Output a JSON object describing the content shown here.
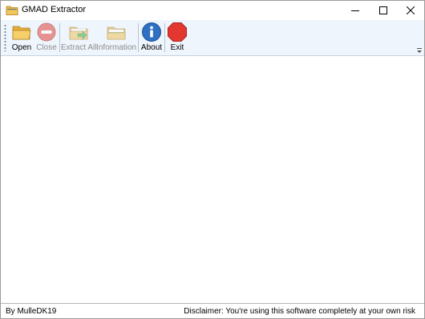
{
  "window": {
    "title": "GMAD Extractor"
  },
  "toolbar": {
    "open": "Open",
    "close": "Close",
    "extract_all": "Extract All",
    "information": "Information",
    "about": "About",
    "exit": "Exit"
  },
  "status": {
    "left": "By MulleDK19",
    "right": "Disclaimer: You're using this software completely at your own risk"
  },
  "icons": {
    "app": "folder-icon",
    "open": "open-folder-icon",
    "close": "close-circle-icon",
    "extract_all": "extract-folder-icon",
    "information": "information-folder-icon",
    "about": "info-icon",
    "exit": "stop-icon"
  }
}
